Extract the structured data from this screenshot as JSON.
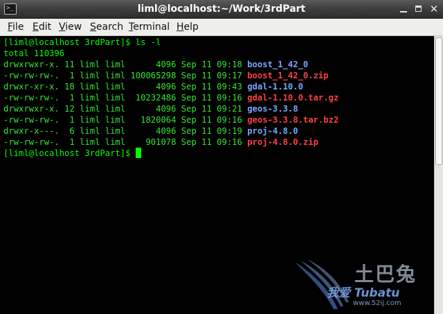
{
  "window": {
    "title": "liml@localhost:~/Work/3rdPart"
  },
  "menu": {
    "items": [
      {
        "mnemonic": "F",
        "rest": "ile"
      },
      {
        "mnemonic": "E",
        "rest": "dit"
      },
      {
        "mnemonic": "V",
        "rest": "iew"
      },
      {
        "mnemonic": "S",
        "rest": "earch"
      },
      {
        "mnemonic": "T",
        "rest": "erminal"
      },
      {
        "mnemonic": "H",
        "rest": "elp"
      }
    ]
  },
  "terminal": {
    "command_line": "[liml@localhost 3rdPart]$ ls -l",
    "total_line": "total 110396",
    "listing": [
      {
        "meta": "drwxrwxr-x. 11 liml liml      4096 Sep 11 09:18 ",
        "name": "boost_1_42_0",
        "kind": "dir"
      },
      {
        "meta": "-rw-rw-rw-.  1 liml liml 100065298 Sep 11 09:17 ",
        "name": "boost_1_42_0.zip",
        "kind": "archive"
      },
      {
        "meta": "drwxr-xr-x. 18 liml liml      4096 Sep 11 09:43 ",
        "name": "gdal-1.10.0",
        "kind": "dir"
      },
      {
        "meta": "-rw-rw-rw-.  1 liml liml  10232486 Sep 11 09:16 ",
        "name": "gdal-1.10.0.tar.gz",
        "kind": "archive"
      },
      {
        "meta": "drwxrwxr-x. 12 liml liml      4096 Sep 11 09:21 ",
        "name": "geos-3.3.8",
        "kind": "dir"
      },
      {
        "meta": "-rw-rw-rw-.  1 liml liml   1820064 Sep 11 09:16 ",
        "name": "geos-3.3.8.tar.bz2",
        "kind": "archive"
      },
      {
        "meta": "drwxr-x---.  6 liml liml      4096 Sep 11 09:19 ",
        "name": "proj-4.8.0",
        "kind": "dir"
      },
      {
        "meta": "-rw-rw-rw-.  1 liml liml    901078 Sep 11 09:16 ",
        "name": "proj-4.8.0.zip",
        "kind": "archive"
      }
    ],
    "prompt": "[liml@localhost 3rdPart]$ "
  },
  "colors": {
    "text": "#00ff00",
    "dir": "#7aa6ff",
    "archive": "#ff4040",
    "background": "#000000"
  },
  "watermark": {
    "big": "土巴兔",
    "mid": "我爱 Tubatu",
    "small": "www.52ij.com"
  }
}
